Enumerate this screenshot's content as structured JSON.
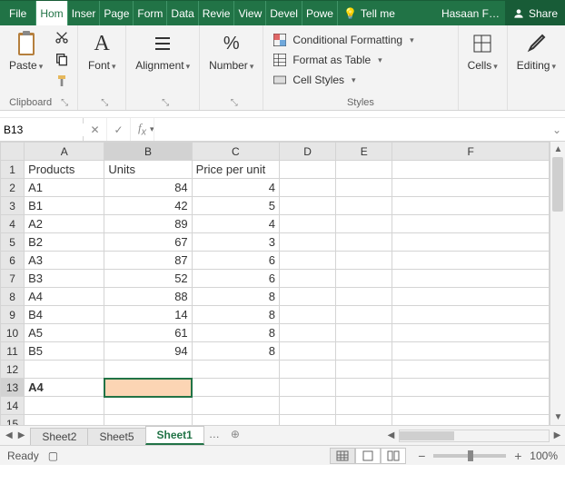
{
  "menu": {
    "file": "File",
    "tabs": [
      "Hom",
      "Inser",
      "Page",
      "Form",
      "Data",
      "Revie",
      "View",
      "Devel",
      "Powe"
    ],
    "tell_me": "Tell me",
    "user": "Hasaan F…",
    "share": "Share"
  },
  "ribbon": {
    "clipboard": {
      "paste": "Paste",
      "label": "Clipboard"
    },
    "font": {
      "btn": "Font",
      "label": "Font"
    },
    "alignment": {
      "btn": "Alignment",
      "label": "Alignment"
    },
    "number": {
      "btn": "Number",
      "label": "Number"
    },
    "styles": {
      "cond": "Conditional Formatting",
      "table": "Format as Table",
      "cell": "Cell Styles",
      "label": "Styles"
    },
    "cells": {
      "btn": "Cells"
    },
    "editing": {
      "btn": "Editing"
    }
  },
  "formula": {
    "namebox": "B13",
    "value": ""
  },
  "grid": {
    "cols": [
      "A",
      "B",
      "C",
      "D",
      "E",
      "F"
    ],
    "headers": {
      "a": "Products",
      "b": "Units",
      "c": "Price per unit"
    },
    "rows": [
      {
        "a": "A1",
        "b": 84,
        "c": 4
      },
      {
        "a": "B1",
        "b": 42,
        "c": 5
      },
      {
        "a": "A2",
        "b": 89,
        "c": 4
      },
      {
        "a": "B2",
        "b": 67,
        "c": 3
      },
      {
        "a": "A3",
        "b": 87,
        "c": 6
      },
      {
        "a": "B3",
        "b": 52,
        "c": 6
      },
      {
        "a": "A4",
        "b": 88,
        "c": 8
      },
      {
        "a": "B4",
        "b": 14,
        "c": 8
      },
      {
        "a": "A5",
        "b": 61,
        "c": 8
      },
      {
        "a": "B5",
        "b": 94,
        "c": 8
      }
    ],
    "row13a": "A4",
    "selected": "B13"
  },
  "tabs": {
    "list": [
      "Sheet2",
      "Sheet5",
      "Sheet1"
    ],
    "active": "Sheet1",
    "more": "…"
  },
  "status": {
    "ready": "Ready",
    "zoom": "100%"
  }
}
